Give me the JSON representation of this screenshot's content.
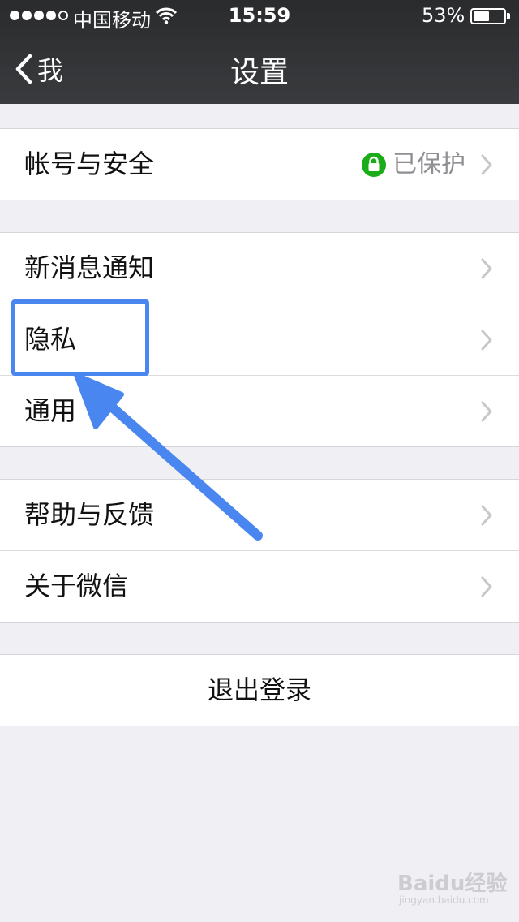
{
  "status_bar": {
    "carrier": "中国移动",
    "time": "15:59",
    "battery_percent": "53%",
    "battery_level": 0.53,
    "signal_bars_filled": 4,
    "signal_bars_total": 5
  },
  "nav": {
    "back_label": "我",
    "title": "设置"
  },
  "groups": [
    {
      "rows": [
        {
          "label": "帐号与安全",
          "value": "已保护",
          "icon": "lock-icon"
        }
      ]
    },
    {
      "rows": [
        {
          "label": "新消息通知"
        },
        {
          "label": "隐私"
        },
        {
          "label": "通用"
        }
      ]
    },
    {
      "rows": [
        {
          "label": "帮助与反馈"
        },
        {
          "label": "关于微信"
        }
      ]
    }
  ],
  "logout": {
    "label": "退出登录"
  },
  "annotation": {
    "color": "#4a86f0",
    "highlighted_item": "隐私"
  },
  "colors": {
    "nav_bg": "#2e2f31",
    "page_bg": "#efeff4",
    "lock_green": "#1aad19"
  },
  "watermark": {
    "brand": "Baidu经验",
    "url": "jingyan.baidu.com"
  }
}
